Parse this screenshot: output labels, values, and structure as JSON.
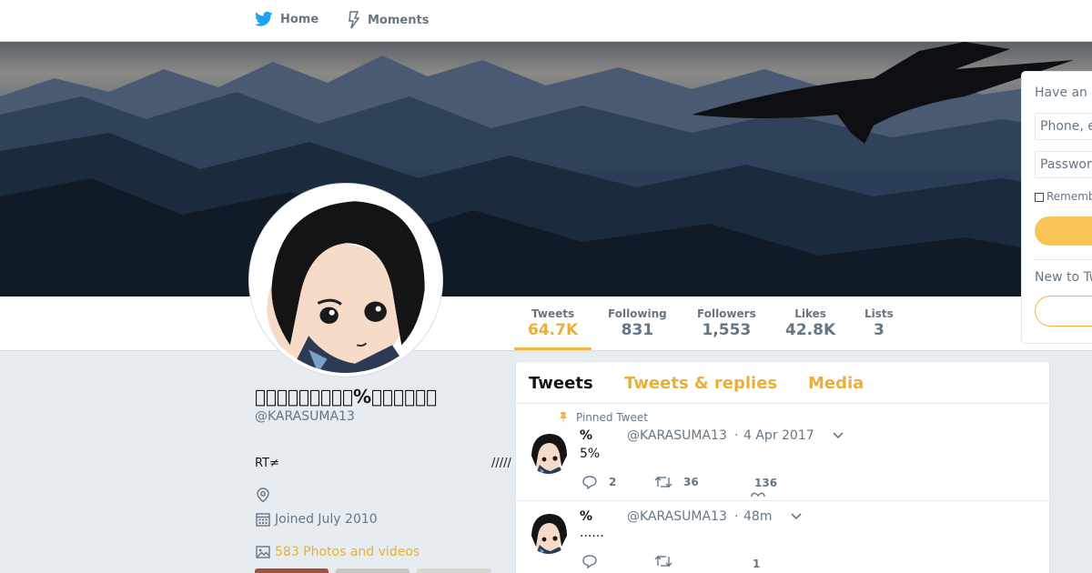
{
  "nav": {
    "home": "Home",
    "moments": "Moments"
  },
  "stats": [
    {
      "label": "Tweets",
      "value": "64.7K"
    },
    {
      "label": "Following",
      "value": "831"
    },
    {
      "label": "Followers",
      "value": "1,553"
    },
    {
      "label": "Likes",
      "value": "42.8K"
    },
    {
      "label": "Lists",
      "value": "3"
    }
  ],
  "profile": {
    "name": "􀀀􀀀􀀀􀀀􀀀􀀀􀀀􀀀􀀀%􀀀􀀀􀀀􀀀􀀀􀀀",
    "handle": "@KARASUMA13",
    "bio": "RT≠",
    "bio_end": "/////",
    "joined": "Joined July 2010",
    "photos": "583 Photos and videos"
  },
  "tabs": [
    "Tweets",
    "Tweets & replies",
    "Media"
  ],
  "tweets": [
    {
      "pinned_label": "Pinned Tweet",
      "name": "%",
      "handle": "@KARASUMA13",
      "separator": "·",
      "time": "4 Apr 2017",
      "text": "5%",
      "replies": "2",
      "retweets": "36",
      "likes": "136"
    },
    {
      "name": "%",
      "handle": "@KARASUMA13",
      "separator": "·",
      "time": "48m",
      "text": "......",
      "replies": "",
      "retweets": "",
      "likes": "1"
    }
  ],
  "login": {
    "title": "Have an",
    "phone_placeholder": "Phone, e",
    "password_placeholder": "Passwor",
    "remember": "Rememb",
    "new_to": "New to Tw"
  },
  "colors": {
    "accent": "#f5b443",
    "twitter_blue": "#1da1f2"
  }
}
